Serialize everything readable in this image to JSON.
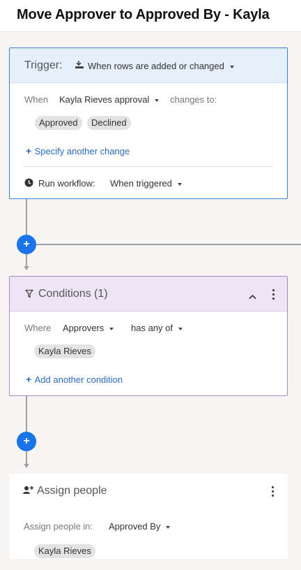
{
  "header": {
    "title": "Move Approver to Approved By - Kayla"
  },
  "trigger": {
    "label": "Trigger:",
    "icon": "grid-rows-icon",
    "type_value": "When rows are added or changed",
    "when_label": "When",
    "column_value": "Kayla Rieves approval",
    "changes_to_label": "changes to:",
    "chips": [
      "Approved",
      "Declined"
    ],
    "add_change_label": "Specify another change",
    "run_label": "Run workflow:",
    "run_value": "When triggered"
  },
  "conditions": {
    "title": "Conditions (1)",
    "where_label": "Where",
    "field_value": "Approvers",
    "operator_value": "has any of",
    "chips": [
      "Kayla Rieves"
    ],
    "add_condition_label": "Add another condition"
  },
  "assign": {
    "title": "Assign people",
    "in_label": "Assign people in:",
    "column_value": "Approved By",
    "chips": [
      "Kayla Rieves"
    ]
  },
  "colors": {
    "accent": "#1a73e8",
    "trigger_border": "#3f7ec8",
    "condition_border": "#a98ac9"
  }
}
